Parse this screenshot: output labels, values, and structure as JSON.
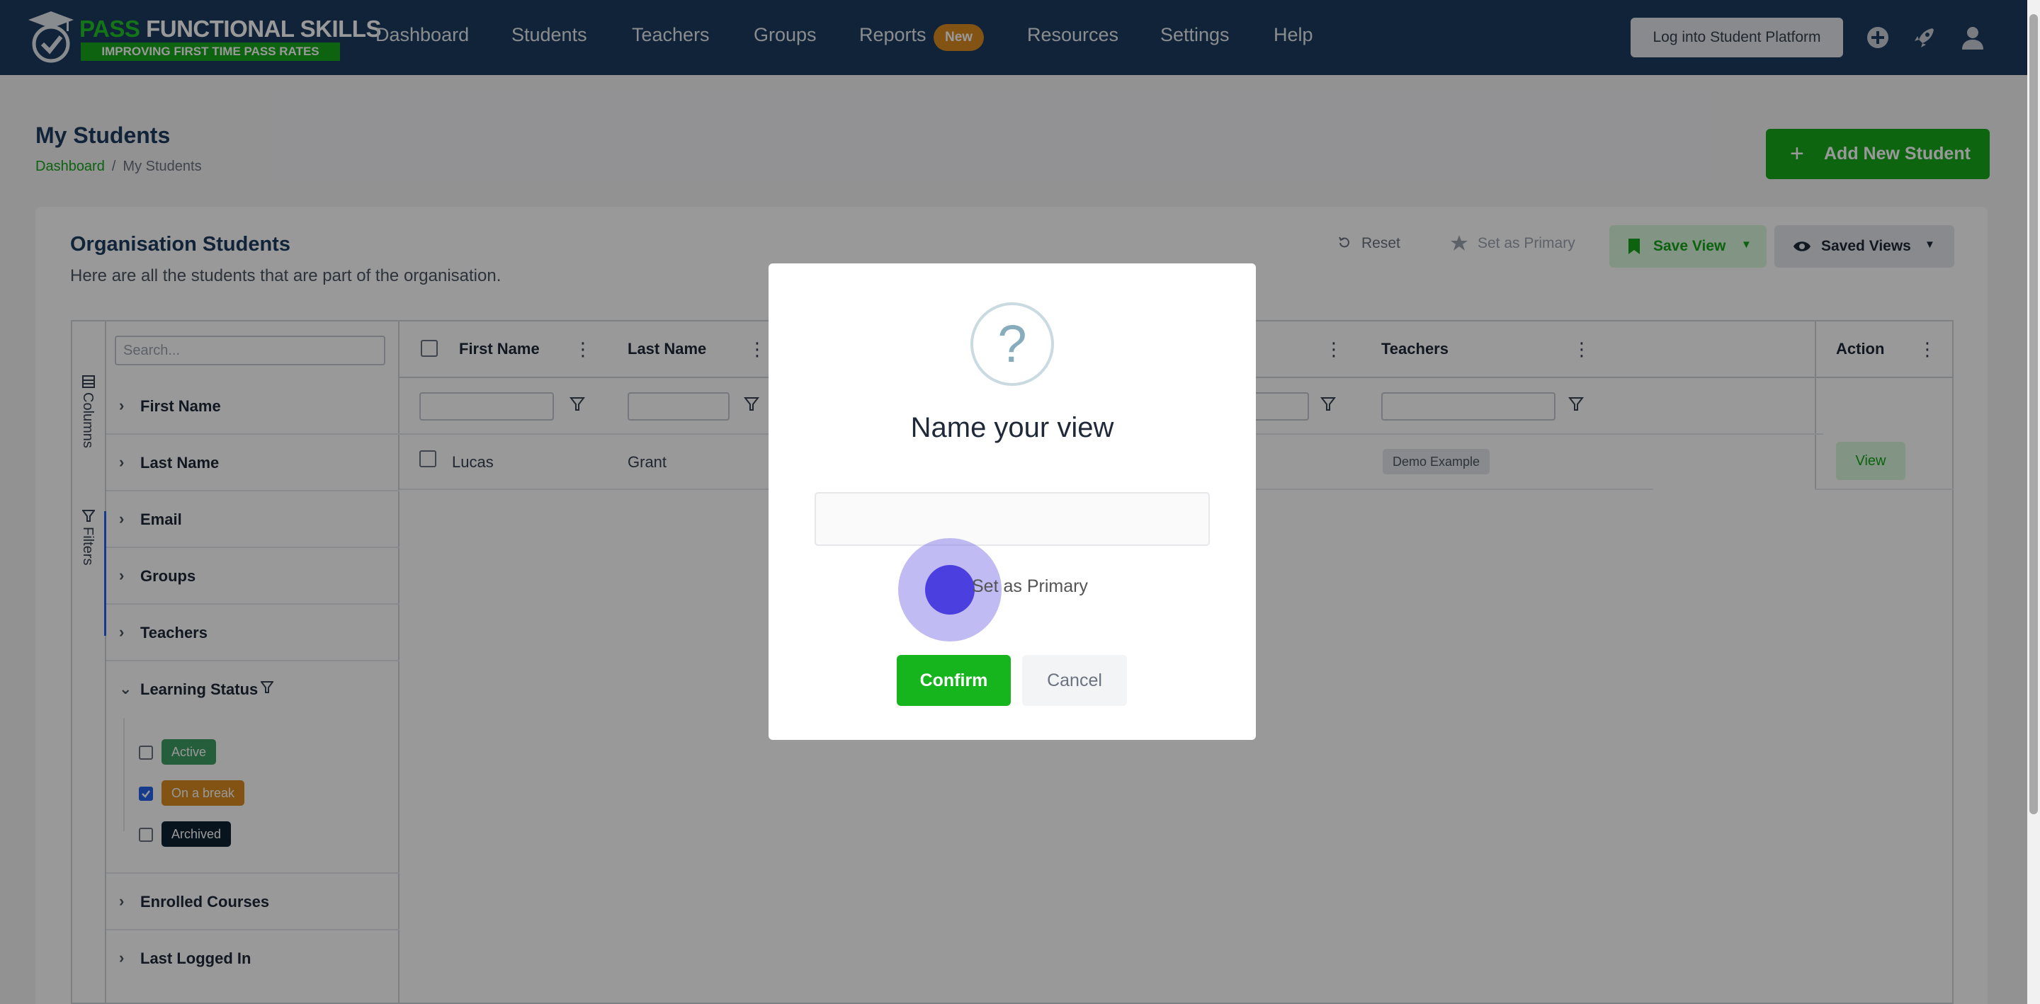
{
  "brand": {
    "title_part1": "PASS",
    "title_part2": " FUNCTIONAL SKILLS",
    "tagline": "IMPROVING FIRST TIME PASS RATES"
  },
  "nav": {
    "items": [
      "Dashboard",
      "Students",
      "Teachers",
      "Groups",
      "Reports",
      "Resources",
      "Settings",
      "Help"
    ],
    "reports_badge": "New",
    "login_button": "Log into Student Platform",
    "icons": [
      "plus-circle-icon",
      "rocket-icon",
      "user-icon"
    ]
  },
  "page": {
    "title": "My Students",
    "breadcrumb": [
      "Dashboard",
      "/",
      "My Students"
    ],
    "add_button": "Add New Student",
    "add_icon": "+"
  },
  "card": {
    "title": "Organisation Students",
    "description": "Here are all the students that are part of the organisation."
  },
  "toolbar": {
    "reset": "Reset",
    "set_primary": "Set as Primary",
    "save_view": "Save View",
    "saved_views": "Saved Views"
  },
  "side_tabs": [
    "Columns",
    "Filters"
  ],
  "filter_panel": {
    "search_placeholder": "Search...",
    "groups": [
      "First Name",
      "Last Name",
      "Email",
      "Groups",
      "Teachers",
      "Learning Status",
      "Enrolled Courses",
      "Last Logged In"
    ],
    "learning_status_options": [
      {
        "label": "Active",
        "checked": false,
        "color": "#3f9d63"
      },
      {
        "label": "On a break",
        "checked": true,
        "color": "#d98a1e"
      },
      {
        "label": "Archived",
        "checked": false,
        "color": "#0c2233"
      }
    ]
  },
  "table": {
    "columns": [
      "First Name",
      "Last Name",
      "Teachers",
      "Action"
    ],
    "rows": [
      {
        "first_name": "Lucas",
        "last_name": "Grant",
        "teachers": "Demo Example",
        "action": "View"
      }
    ]
  },
  "modal": {
    "icon": "?",
    "title": "Name your view",
    "input_value": "",
    "checkbox_label": "Set as Primary",
    "confirm": "Confirm",
    "cancel": "Cancel"
  },
  "colors": {
    "navbar": "#1c3b5e",
    "brand_green": "#16a91c",
    "checkbox_accent": "#4c3fe0"
  }
}
